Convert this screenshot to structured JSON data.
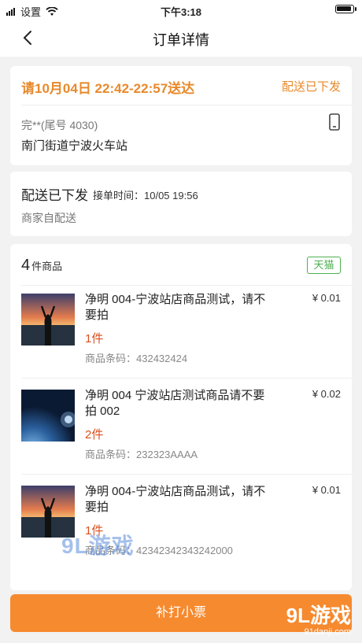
{
  "status_bar": {
    "carrier": "设置",
    "time": "下午3:18"
  },
  "nav": {
    "title": "订单详情"
  },
  "delivery": {
    "time_line": "请10月04日 22:42-22:57送达",
    "status": "配送已下发",
    "contact": "完**(尾号 4030)",
    "address": "南门街道宁波火车站"
  },
  "dispatch": {
    "status": "配送已下发",
    "accept_time": "接单时间：10/05 19:56",
    "method": "商家自配送"
  },
  "goods": {
    "count": "4",
    "count_unit": "件商品",
    "platform_tag": "天猫",
    "items": [
      {
        "name": "净明 004-宁波站店商品测试，请不要拍",
        "price": "¥ 0.01",
        "qty": "1件",
        "code": "商品条码：432432424"
      },
      {
        "name": "净明 004 宁波站店测试商品请不要拍 002",
        "price": "¥ 0.02",
        "qty": "2件",
        "code": "商品条码：232323AAAA"
      },
      {
        "name": "净明 004-宁波站店商品测试，请不要拍",
        "price": "¥ 0.01",
        "qty": "1件",
        "code": "商品条码：42342342343242000"
      }
    ]
  },
  "footer": {
    "reprint_label": "补打小票"
  },
  "watermark": {
    "center_text": "9L游戏",
    "corner_text": "9L游戏",
    "corner_url": "91danji.com"
  },
  "colors": {
    "accent": "#e8892b",
    "button": "#f68a2f",
    "quantity": "#d9501f",
    "tag_green": "#4caf50"
  }
}
